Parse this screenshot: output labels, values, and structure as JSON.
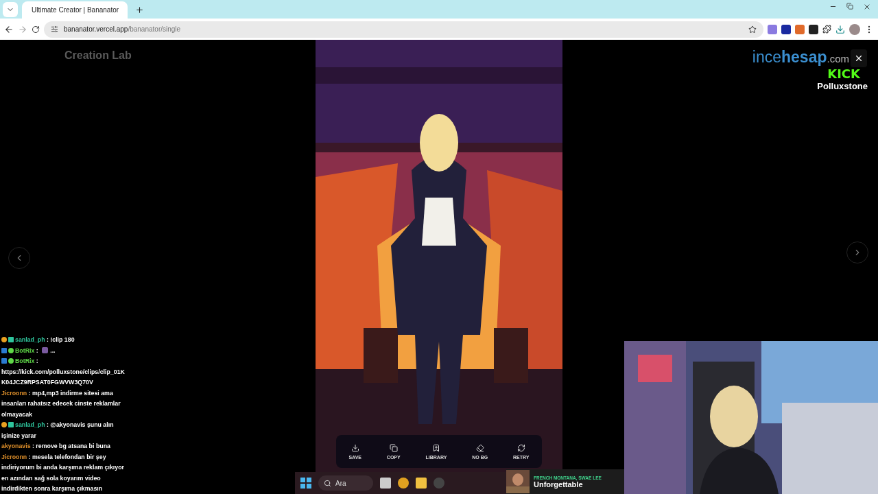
{
  "browser": {
    "tabs": [
      {
        "title": "Ultimate Creator | Bananator",
        "selected": true
      }
    ],
    "url": {
      "host": "bananator.vercel.app",
      "path": "/bananator/single"
    }
  },
  "page": {
    "background_title": "Creation Lab",
    "actions": [
      {
        "kind": "save",
        "label": "SAVE"
      },
      {
        "kind": "copy",
        "label": "COPY"
      },
      {
        "kind": "library",
        "label": "LIBRARY"
      },
      {
        "kind": "nobg",
        "label": "NO BG"
      },
      {
        "kind": "retry",
        "label": "RETRY"
      }
    ]
  },
  "overlay": {
    "brand": {
      "light": "ince",
      "bold": "hesap",
      "suffix": ".com"
    },
    "platform": "KICK",
    "channel": "Polluxstone"
  },
  "chat": [
    {
      "kind": "sub",
      "user": "sanlad_ph",
      "color": "#2ec49c",
      "text": ": !clip 180"
    },
    {
      "kind": "bot",
      "user": "BotRix",
      "color": "#5fd848",
      "text": ": ",
      "emote": true,
      "after": "..."
    },
    {
      "kind": "bot",
      "user": "BotRix",
      "color": "#5fd848",
      "text": ": https://kick.com/polluxstone/clips/clip_01KK04JCZ9RPSAT0FGWVW3Q70V"
    },
    {
      "kind": "plain",
      "user": "Jicroonn",
      "color": "#e0902a",
      "text": ": mp4,mp3 indirme sitesi ama insanları rahatsız edecek cinste reklamlar olmayacak"
    },
    {
      "kind": "sub",
      "user": "sanlad_ph",
      "color": "#2ec49c",
      "text": ": @akyonavis şunu alın işinize yarar"
    },
    {
      "kind": "plain",
      "user": "akyonavis",
      "color": "#e0902a",
      "text": ": remove bg atsana bi buna"
    },
    {
      "kind": "plain",
      "user": "Jicroonn",
      "color": "#e0902a",
      "text": ": mesela telefondan bir şey indiriyorum bi anda karşıma reklam çıkıyor en azından sağ sola koyarım video indirdikten sonra karşıma çıkmasın"
    }
  ],
  "taskbar": {
    "search": {
      "placeholder": "Ara"
    },
    "music": {
      "artist": "FRENCH MONTANA, SWAE LEE",
      "title": "Unforgettable"
    }
  }
}
